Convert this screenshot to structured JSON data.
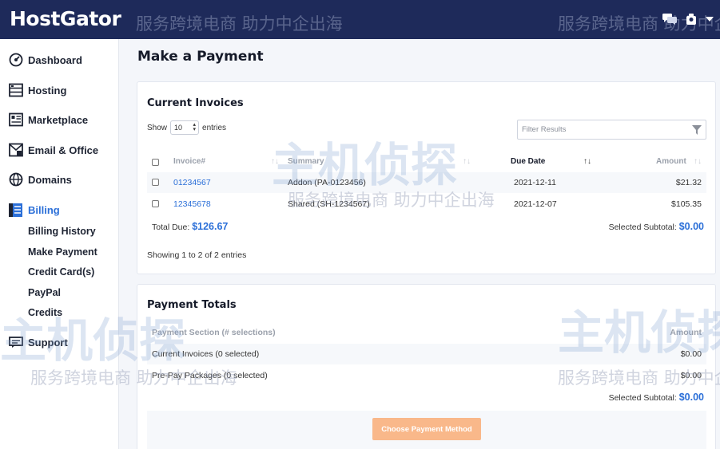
{
  "header": {
    "logo": "HostGator"
  },
  "sidebar": {
    "items": [
      {
        "label": "Dashboard",
        "icon": "dashboard-icon"
      },
      {
        "label": "Hosting",
        "icon": "server-icon"
      },
      {
        "label": "Marketplace",
        "icon": "store-icon"
      },
      {
        "label": "Email & Office",
        "icon": "mail-icon"
      },
      {
        "label": "Domains",
        "icon": "globe-icon"
      },
      {
        "label": "Billing",
        "icon": "billing-icon",
        "active": true
      },
      {
        "label": "Support",
        "icon": "support-icon"
      }
    ],
    "billing_sub": [
      "Billing History",
      "Make Payment",
      "Credit Card(s)",
      "PayPal",
      "Credits"
    ]
  },
  "page": {
    "title": "Make a Payment"
  },
  "invoices": {
    "title": "Current Invoices",
    "show_label": "Show",
    "page_size": "10",
    "entries_label": "entries",
    "filter_placeholder": "Filter Results",
    "columns": [
      "Invoice#",
      "Summary",
      "Due Date",
      "Amount"
    ],
    "rows": [
      {
        "invoice": "01234567",
        "summary": "Addon (PA-0123456)",
        "due": "2021-12-11",
        "amount": "$21.32"
      },
      {
        "invoice": "12345678",
        "summary": "Shared (SH-1234567)",
        "due": "2021-12-07",
        "amount": "$105.35"
      }
    ],
    "total_due_label": "Total Due:",
    "total_due_value": "$126.67",
    "subtotal_label": "Selected Subtotal:",
    "subtotal_value": "$0.00",
    "showing_text": "Showing 1 to 2 of 2 entries"
  },
  "totals": {
    "title": "Payment Totals",
    "columns": [
      "Payment Section (# selections)",
      "Amount"
    ],
    "rows": [
      {
        "section": "Current Invoices (0 selected)",
        "amount": "$0.00"
      },
      {
        "section": "Pre-Pay Packages (0 selected)",
        "amount": "$0.00"
      }
    ],
    "subtotal_label": "Selected Subtotal:",
    "subtotal_value": "$0.00",
    "pay_button": "Choose Payment Method"
  },
  "watermark": {
    "cn_brand": "主机侦探",
    "cn_text": "服务跨境电商 助力中企出海"
  },
  "colors": {
    "header_bg": "#1e2a5a",
    "accent": "#2b6fd8",
    "button": "#f9b88a"
  }
}
